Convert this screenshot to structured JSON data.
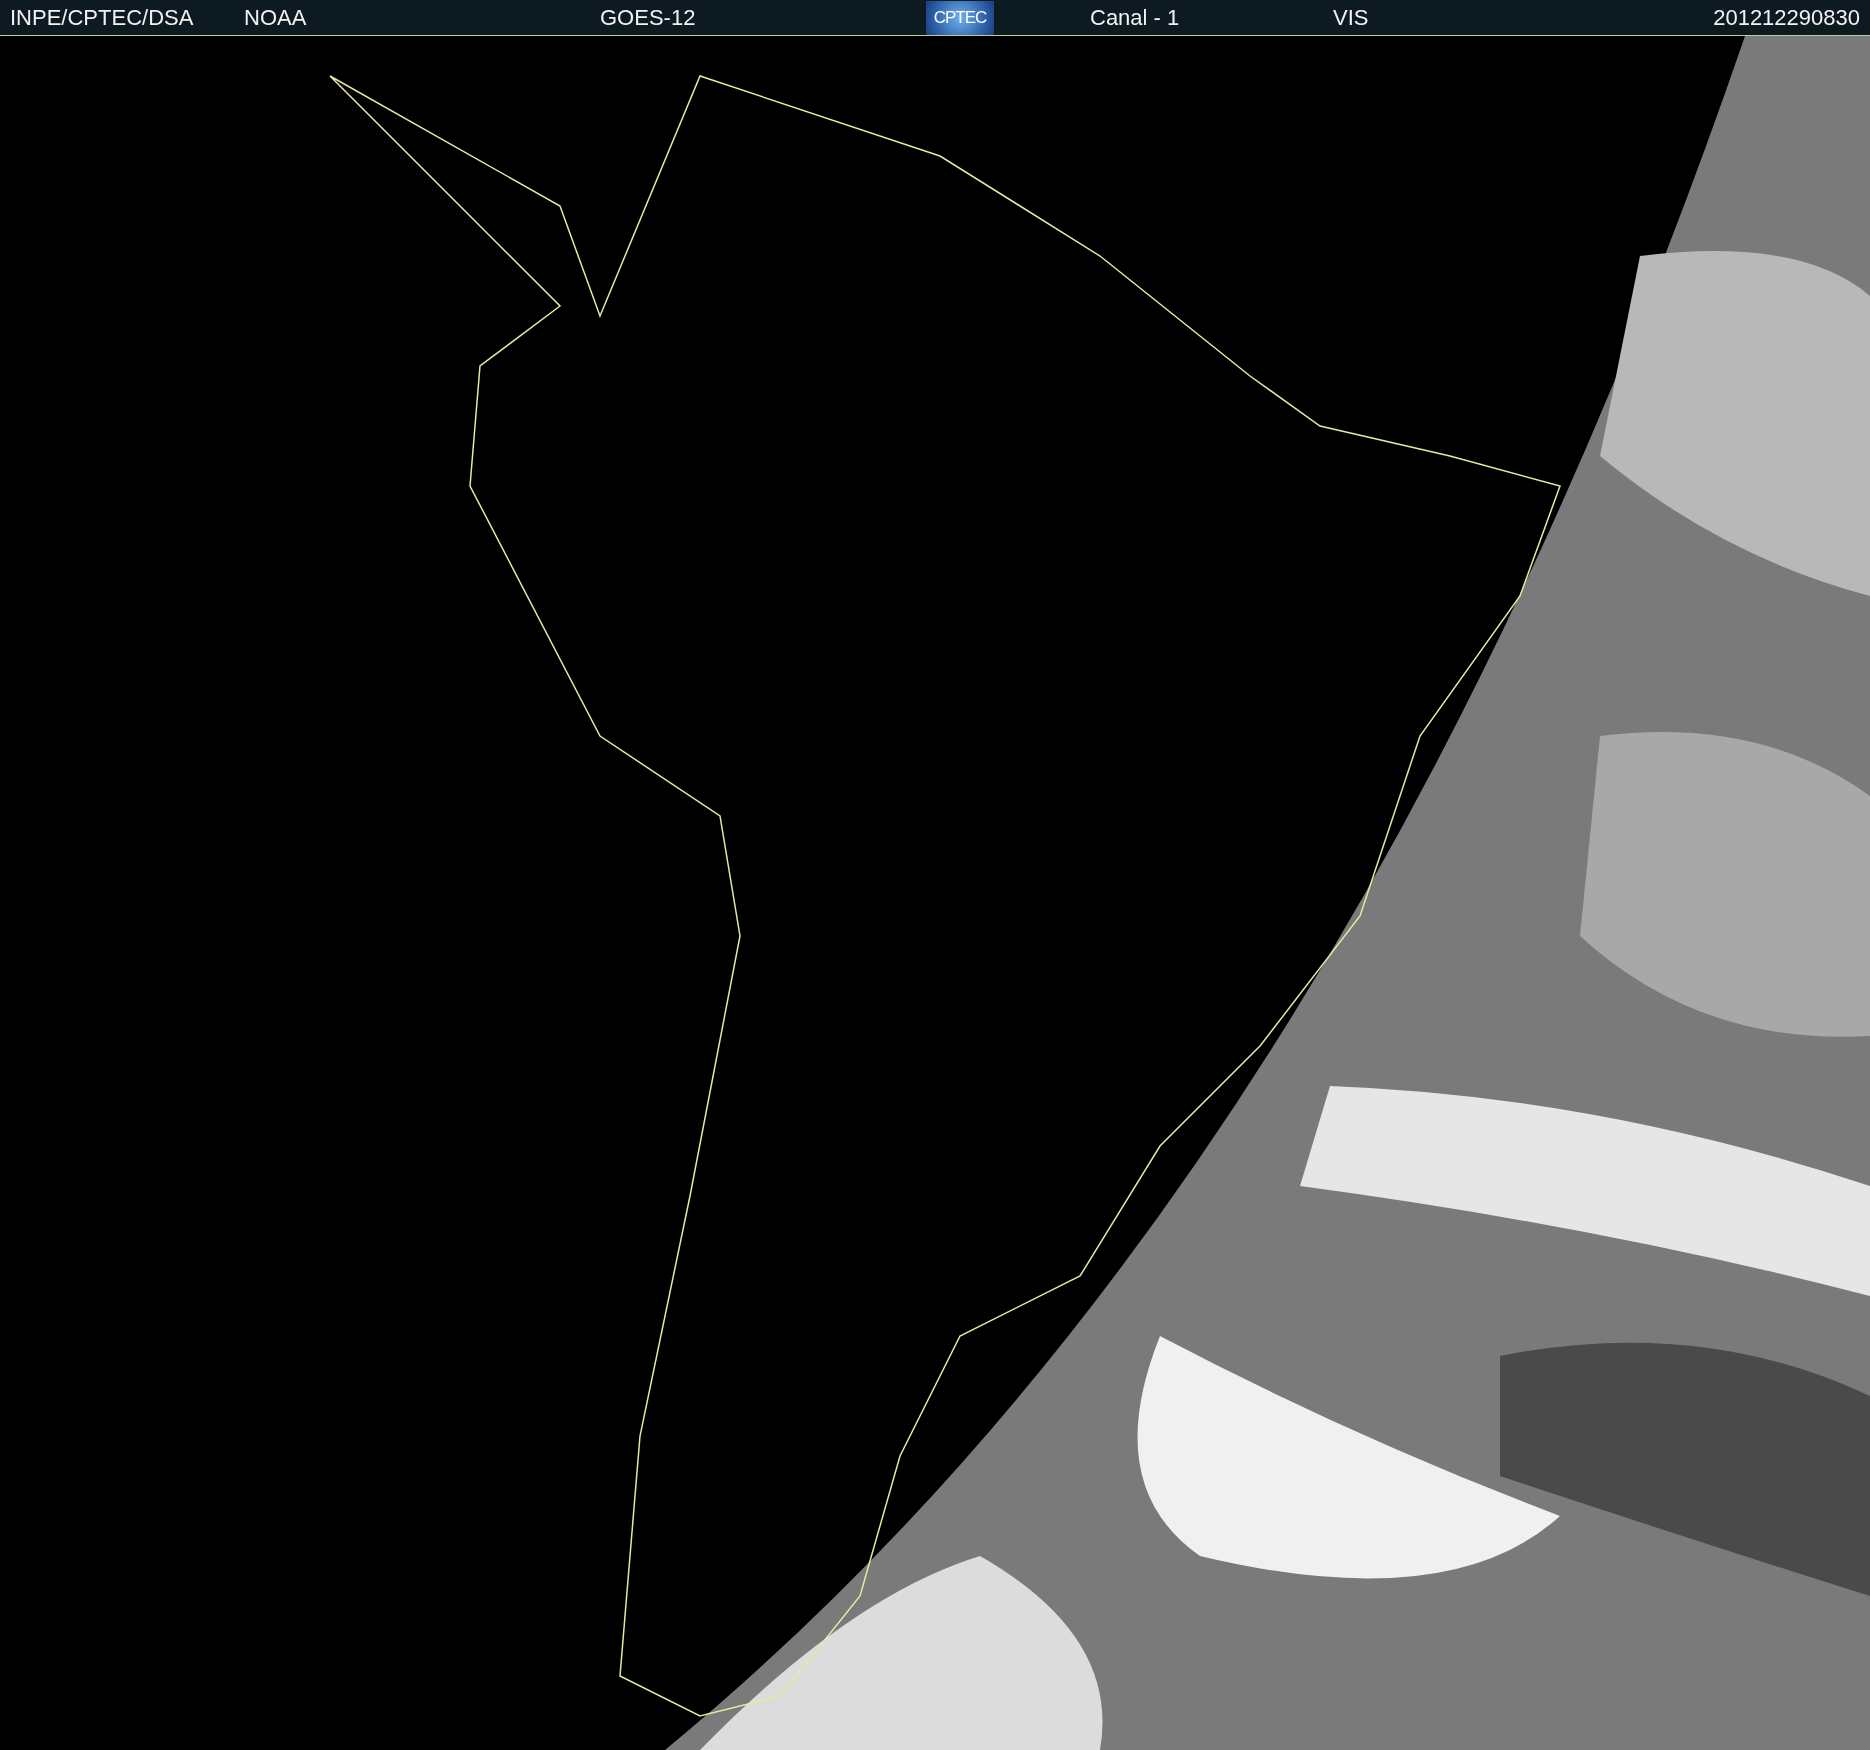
{
  "header": {
    "source": "INPE/CPTEC/DSA",
    "agency": "NOAA",
    "satellite": "GOES-12",
    "logo": "CPTEC",
    "channel": "Canal - 1",
    "band": "VIS",
    "timestamp": "201212290830"
  }
}
